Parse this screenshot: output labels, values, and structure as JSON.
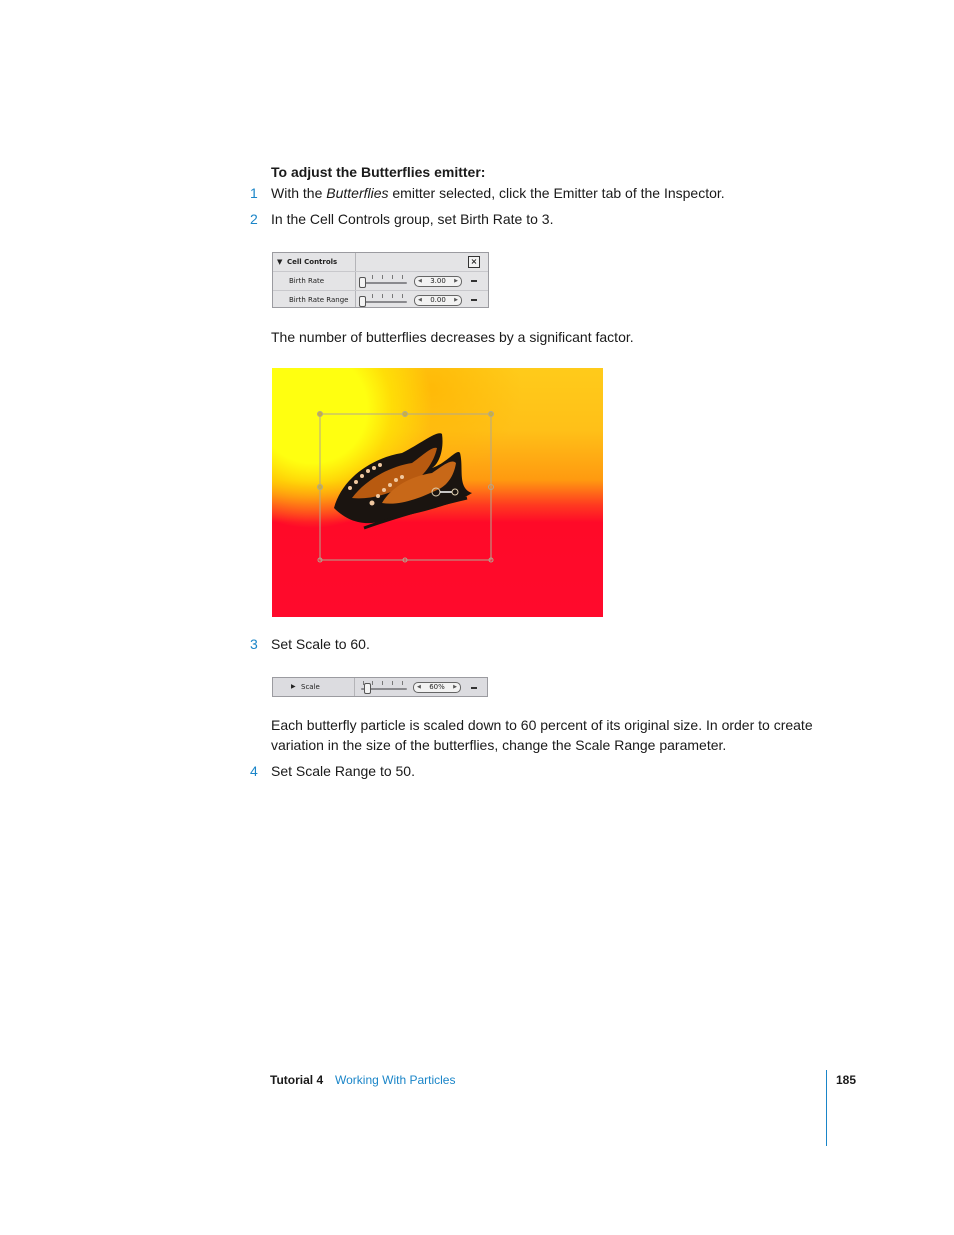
{
  "heading": "To adjust the Butterflies emitter:",
  "steps": [
    {
      "number": "1",
      "text_before": "With the ",
      "text_italic": "Butterflies",
      "text_after": " emitter selected, click the Emitter tab of the Inspector."
    },
    {
      "number": "2",
      "text": "In the Cell Controls group, set Birth Rate to 3."
    },
    {
      "number": "3",
      "text": "Set Scale to 60."
    },
    {
      "number": "4",
      "text": "Set Scale Range to 50."
    }
  ],
  "cell_controls_panel": {
    "group_label": "Cell Controls",
    "rows": [
      {
        "label": "Birth Rate",
        "value": "3.00",
        "slider_fraction": 0.0
      },
      {
        "label": "Birth Rate Range",
        "value": "0.00",
        "slider_fraction": 0.0
      }
    ]
  },
  "para_after_step2": "The number of butterflies decreases by a significant factor.",
  "scale_panel": {
    "label": "Scale",
    "value": "60%",
    "slider_fraction": 0.15
  },
  "para_after_step3": "Each butterfly particle is scaled down to 60 percent of its original size. In order to create variation in the size of the butterflies, change the Scale Range parameter.",
  "canvas_image": {
    "description": "Canvas showing butterfly particles over a yellow-to-red sunset gradient with emitter bounding box"
  },
  "footer": {
    "chapter": "Tutorial 4",
    "title": "Working With Particles",
    "page": "185"
  },
  "colors": {
    "accent": "#1a85c8",
    "canvas_top": "#ffcb1a",
    "canvas_bottom": "#ff0a2c"
  }
}
